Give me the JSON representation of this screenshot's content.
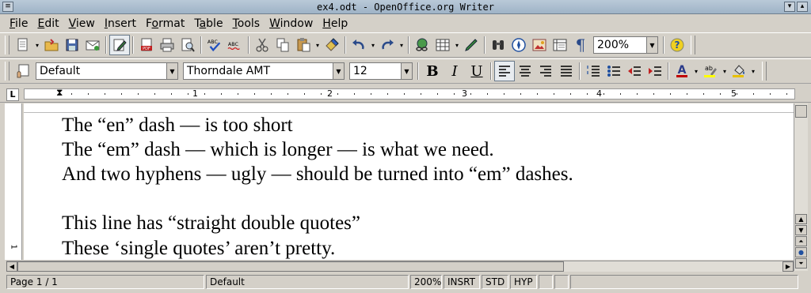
{
  "window": {
    "title": "ex4.odt - OpenOffice.org Writer"
  },
  "menu": [
    {
      "label": "File",
      "accel": "F"
    },
    {
      "label": "Edit",
      "accel": "E"
    },
    {
      "label": "View",
      "accel": "V"
    },
    {
      "label": "Insert",
      "accel": "I"
    },
    {
      "label": "Format",
      "accel": "o"
    },
    {
      "label": "Table",
      "accel": "a"
    },
    {
      "label": "Tools",
      "accel": "T"
    },
    {
      "label": "Window",
      "accel": "W"
    },
    {
      "label": "Help",
      "accel": "H"
    }
  ],
  "toolbar": {
    "zoom_value": "200%",
    "spellcheck_label": "ABC",
    "autospell_label": "ABC",
    "pdf_label": "PDF"
  },
  "formatting": {
    "style_value": "Default",
    "font_value": "Thorndale AMT",
    "size_value": "12",
    "bold_label": "B",
    "italic_label": "I",
    "underline_label": "U"
  },
  "ruler": {
    "marks": [
      "1",
      "2",
      "3",
      "4",
      "5"
    ],
    "vertical_mark": "1"
  },
  "document": {
    "lines": [
      "The “en” dash — is too short",
      "The “em” dash — which is longer — is what we need.",
      "And two hyphens — ugly — should be turned into “em” dashes.",
      "",
      "This line has “straight double quotes”",
      "These ‘single quotes’ aren’t pretty."
    ]
  },
  "status": {
    "page": "Page 1 / 1",
    "style": "Default",
    "zoom": "200%",
    "insert_mode": "INSRT",
    "selection_mode": "STD",
    "hyperlink_mode": "HYP"
  },
  "colors": {
    "font_color": "#c00000",
    "highlight": "#ffff00",
    "background_fill": "#e8c000"
  }
}
